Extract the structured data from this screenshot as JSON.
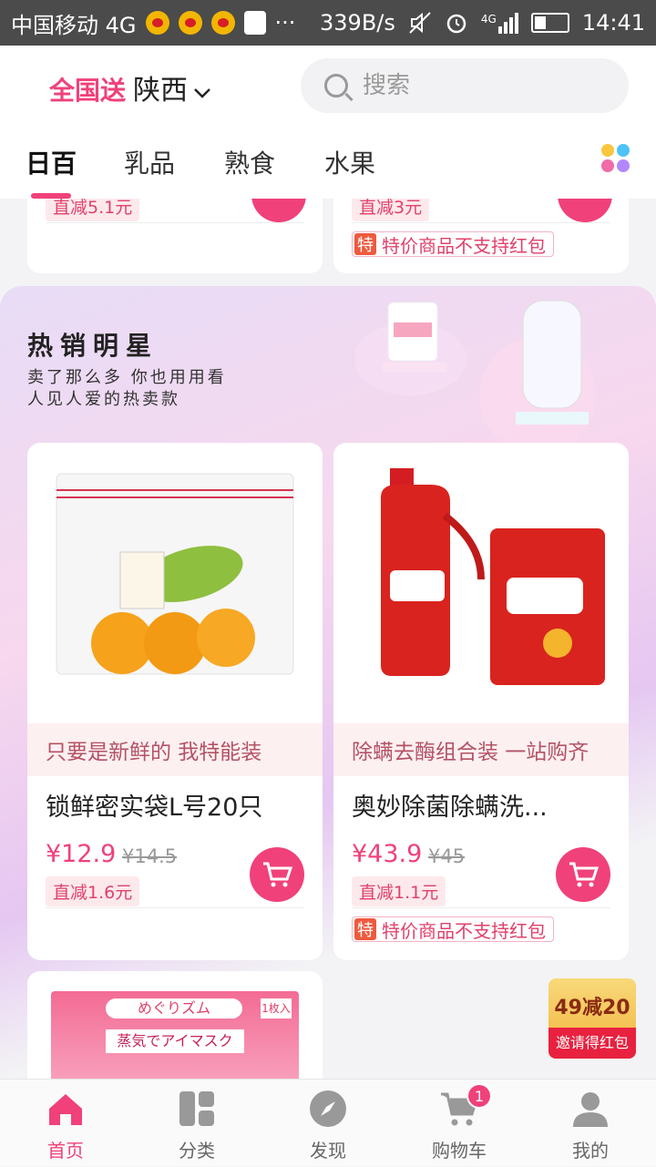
{
  "status_bar": {
    "carrier": "中国移动 4G",
    "net_speed": "339B/s",
    "network": "4G",
    "time": "14:41",
    "ellipsis": "···"
  },
  "header": {
    "region_label": "全国送",
    "province": "陕西",
    "search_placeholder": "搜索"
  },
  "tabs": [
    {
      "label": "日百",
      "active": true
    },
    {
      "label": "乳品",
      "active": false
    },
    {
      "label": "熟食",
      "active": false
    },
    {
      "label": "水果",
      "active": false
    }
  ],
  "top_cards": [
    {
      "discount": "直减5.1元"
    },
    {
      "discount": "直减3元",
      "notice_tag": "特",
      "notice": "特价商品不支持红包"
    }
  ],
  "hot_section": {
    "title": "热销明星",
    "subtitle_line1": "卖了那么多 你也用用看",
    "subtitle_line2": "人见人爱的热卖款"
  },
  "products": [
    {
      "slogan": "只要是新鲜的 我特能装",
      "name": "锁鲜密实袋L号20只",
      "price": "¥12.9",
      "old_price": "¥14.5",
      "discount": "直减1.6元"
    },
    {
      "slogan": "除螨去酶组合装 一站购齐",
      "name": "奥妙除菌除螨洗...",
      "price": "¥43.9",
      "old_price": "¥45",
      "discount": "直减1.1元",
      "notice_tag": "特",
      "notice": "特价商品不支持红包"
    }
  ],
  "partial_product": {
    "brand": "めぐりズム",
    "line": "蒸気でアイマスク",
    "count": "1枚入"
  },
  "red_packet": {
    "top": "49减20",
    "bottom": "邀请得红包"
  },
  "bottom_nav": [
    {
      "label": "首页",
      "icon": "home-icon",
      "active": true
    },
    {
      "label": "分类",
      "icon": "category-icon",
      "active": false
    },
    {
      "label": "发现",
      "icon": "compass-icon",
      "active": false
    },
    {
      "label": "购物车",
      "icon": "cart-icon",
      "active": false,
      "badge": "1"
    },
    {
      "label": "我的",
      "icon": "profile-icon",
      "active": false
    }
  ],
  "colors": {
    "accent": "#f0417a",
    "status_bar": "#4b4b4b"
  }
}
